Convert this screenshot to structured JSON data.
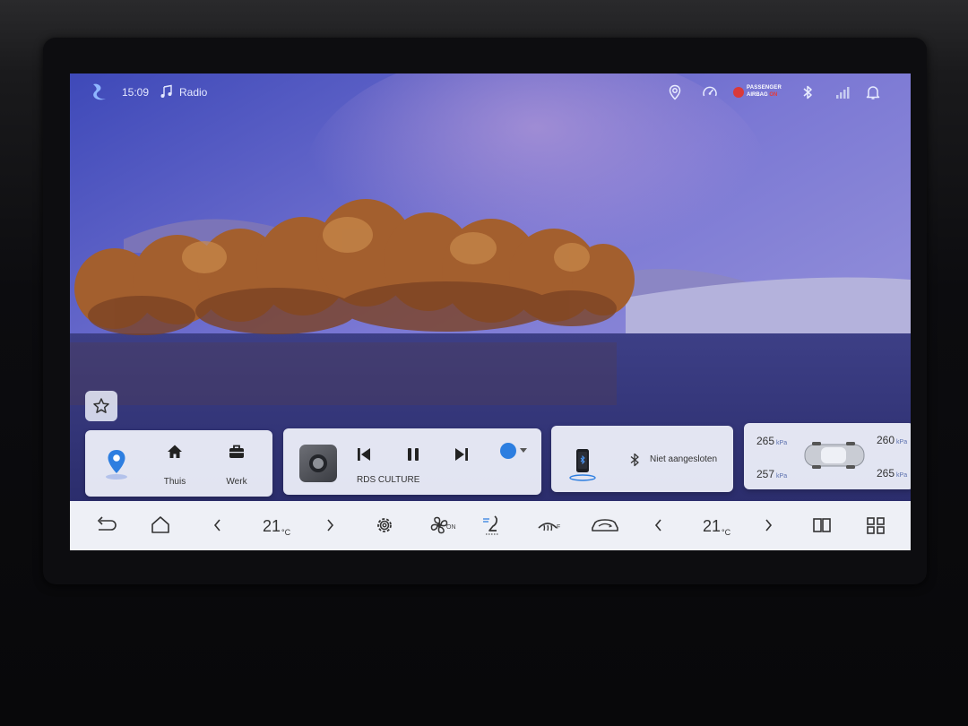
{
  "status_bar": {
    "time": "15:09",
    "source": "Radio",
    "airbag_line1": "PASSENGER",
    "airbag_line2_prefix": "AIRBAG",
    "airbag_line2_state": "ON",
    "icons": [
      "app-logo-icon",
      "music-note-icon",
      "location-icon",
      "speedometer-icon",
      "airbag-indicator-icon",
      "bluetooth-icon",
      "signal-icon",
      "bell-icon"
    ]
  },
  "navigation": {
    "home_label": "Thuis",
    "work_label": "Werk"
  },
  "media": {
    "station": "RDS CULTURE"
  },
  "phone": {
    "bluetooth_status": "Niet aangesloten"
  },
  "tires": {
    "front_left": "265",
    "front_right": "260",
    "rear_left": "257",
    "rear_right": "265",
    "unit": "kPa"
  },
  "climate": {
    "left_temp": "21",
    "right_temp": "21",
    "temp_unit": "°C",
    "fan_label": "ON",
    "defrost_label": "F"
  },
  "colors": {
    "sky_top": "#5862c8",
    "sky_mid": "#8a86d8",
    "card_bg": "#eef0fa",
    "accent_blue": "#2d7ee0",
    "airbag_red": "#d93a3a"
  }
}
